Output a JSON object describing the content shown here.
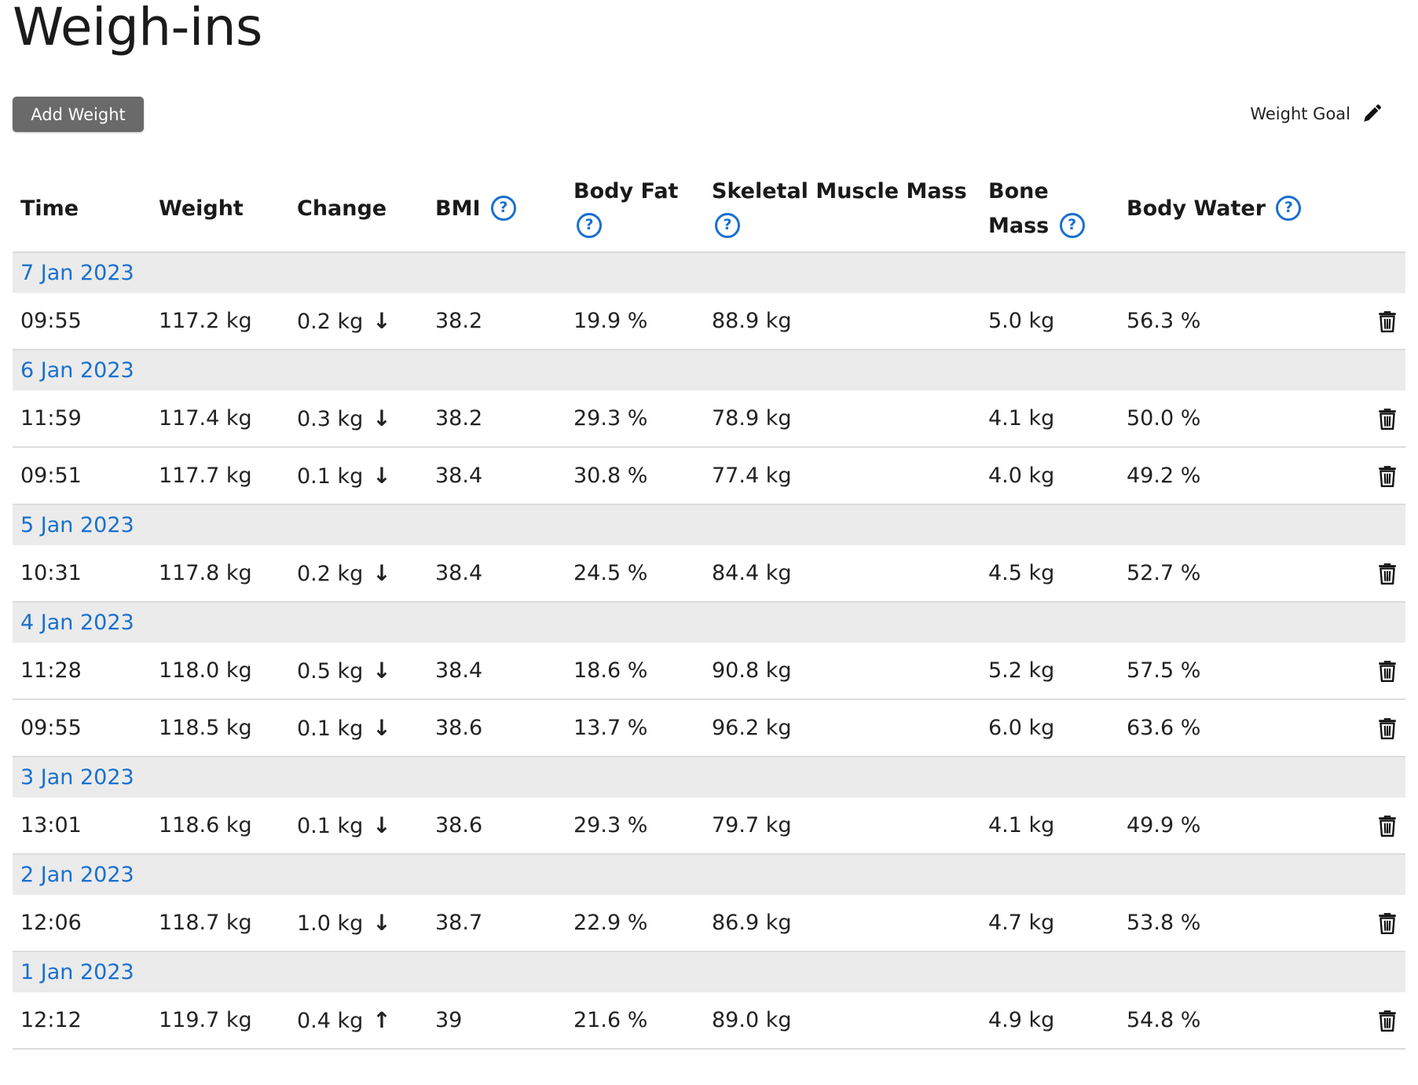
{
  "page": {
    "title": "Weigh-ins"
  },
  "toolbar": {
    "add_weight_label": "Add Weight",
    "weight_goal_label": "Weight Goal"
  },
  "table": {
    "headers": {
      "time": "Time",
      "weight": "Weight",
      "change": "Change",
      "bmi": "BMI",
      "body_fat": "Body Fat",
      "skeletal_muscle_mass": "Skeletal Muscle Mass",
      "bone_mass": "Bone Mass",
      "body_water": "Body Water"
    },
    "help_glyph": "?",
    "groups": [
      {
        "date": "7 Jan 2023",
        "entries": [
          {
            "time": "09:55",
            "weight": "117.2 kg",
            "change": "0.2 kg",
            "arrow": "↓",
            "bmi": "38.2",
            "body_fat": "19.9 %",
            "skeletal_muscle_mass": "88.9 kg",
            "bone_mass": "5.0 kg",
            "body_water": "56.3 %"
          }
        ]
      },
      {
        "date": "6 Jan 2023",
        "entries": [
          {
            "time": "11:59",
            "weight": "117.4 kg",
            "change": "0.3 kg",
            "arrow": "↓",
            "bmi": "38.2",
            "body_fat": "29.3 %",
            "skeletal_muscle_mass": "78.9 kg",
            "bone_mass": "4.1 kg",
            "body_water": "50.0 %"
          },
          {
            "time": "09:51",
            "weight": "117.7 kg",
            "change": "0.1 kg",
            "arrow": "↓",
            "bmi": "38.4",
            "body_fat": "30.8 %",
            "skeletal_muscle_mass": "77.4 kg",
            "bone_mass": "4.0 kg",
            "body_water": "49.2 %"
          }
        ]
      },
      {
        "date": "5 Jan 2023",
        "entries": [
          {
            "time": "10:31",
            "weight": "117.8 kg",
            "change": "0.2 kg",
            "arrow": "↓",
            "bmi": "38.4",
            "body_fat": "24.5 %",
            "skeletal_muscle_mass": "84.4 kg",
            "bone_mass": "4.5 kg",
            "body_water": "52.7 %"
          }
        ]
      },
      {
        "date": "4 Jan 2023",
        "entries": [
          {
            "time": "11:28",
            "weight": "118.0 kg",
            "change": "0.5 kg",
            "arrow": "↓",
            "bmi": "38.4",
            "body_fat": "18.6 %",
            "skeletal_muscle_mass": "90.8 kg",
            "bone_mass": "5.2 kg",
            "body_water": "57.5 %"
          },
          {
            "time": "09:55",
            "weight": "118.5 kg",
            "change": "0.1 kg",
            "arrow": "↓",
            "bmi": "38.6",
            "body_fat": "13.7 %",
            "skeletal_muscle_mass": "96.2 kg",
            "bone_mass": "6.0 kg",
            "body_water": "63.6 %"
          }
        ]
      },
      {
        "date": "3 Jan 2023",
        "entries": [
          {
            "time": "13:01",
            "weight": "118.6 kg",
            "change": "0.1 kg",
            "arrow": "↓",
            "bmi": "38.6",
            "body_fat": "29.3 %",
            "skeletal_muscle_mass": "79.7 kg",
            "bone_mass": "4.1 kg",
            "body_water": "49.9 %"
          }
        ]
      },
      {
        "date": "2 Jan 2023",
        "entries": [
          {
            "time": "12:06",
            "weight": "118.7 kg",
            "change": "1.0 kg",
            "arrow": "↓",
            "bmi": "38.7",
            "body_fat": "22.9 %",
            "skeletal_muscle_mass": "86.9 kg",
            "bone_mass": "4.7 kg",
            "body_water": "53.8 %"
          }
        ]
      },
      {
        "date": "1 Jan 2023",
        "entries": [
          {
            "time": "12:12",
            "weight": "119.7 kg",
            "change": "0.4 kg",
            "arrow": "↑",
            "bmi": "39",
            "body_fat": "21.6 %",
            "skeletal_muscle_mass": "89.0 kg",
            "bone_mass": "4.9 kg",
            "body_water": "54.8 %"
          }
        ]
      }
    ]
  },
  "icons": {
    "help": "question-circle-icon",
    "edit": "pencil-icon",
    "delete": "trash-icon"
  },
  "colors": {
    "link_blue": "#1a6fd0",
    "button_gray": "#6a6a6a",
    "date_row_bg": "#ebebeb"
  }
}
